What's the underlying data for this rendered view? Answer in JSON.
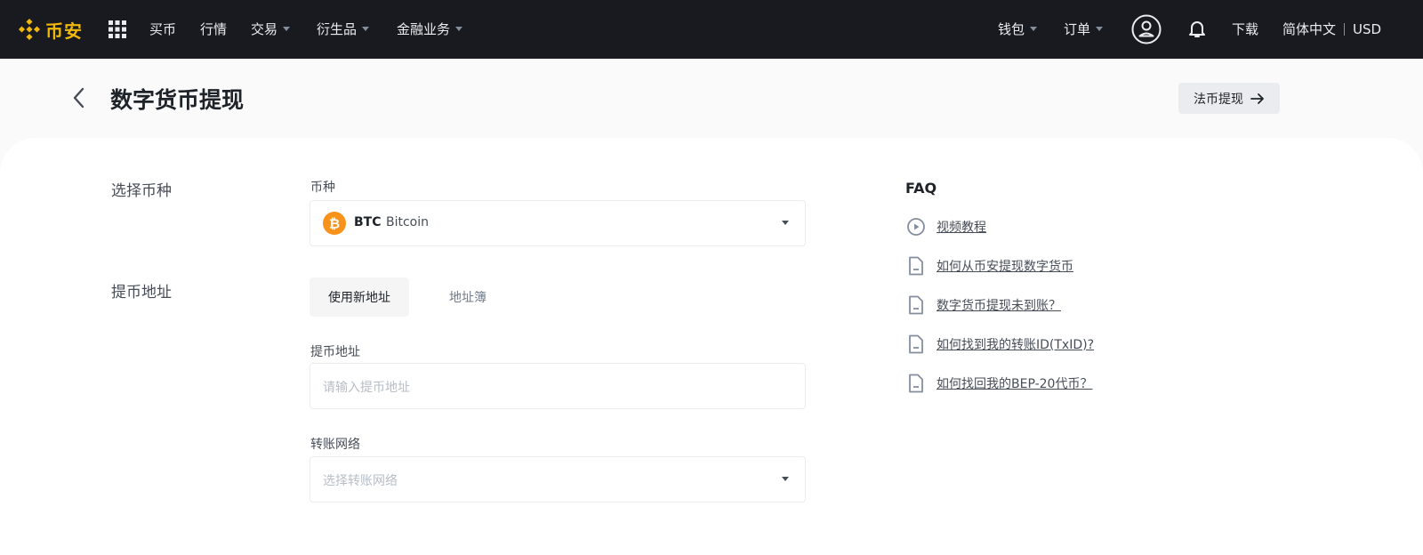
{
  "brand": {
    "name": "币安",
    "color": "#f0b90b",
    "icon": "binance-logo-icon"
  },
  "nav": {
    "items": [
      {
        "label": "买币",
        "dropdown": false
      },
      {
        "label": "行情",
        "dropdown": false
      },
      {
        "label": "交易",
        "dropdown": true
      },
      {
        "label": "衍生品",
        "dropdown": true
      },
      {
        "label": "金融业务",
        "dropdown": true
      }
    ],
    "right": {
      "wallet": "钱包",
      "orders": "订单",
      "download": "下载",
      "language": "简体中文",
      "currency": "USD"
    }
  },
  "header": {
    "title": "数字货币提现",
    "fiat_button": "法币提现"
  },
  "form": {
    "select_coin_section": "选择币种",
    "coin_label": "币种",
    "coin": {
      "symbol": "BTC",
      "name": "Bitcoin",
      "icon": "bitcoin-icon",
      "icon_color": "#f7931a"
    },
    "address_section": "提币地址",
    "tabs": [
      {
        "label": "使用新地址",
        "active": true
      },
      {
        "label": "地址簿",
        "active": false
      }
    ],
    "address_label": "提币地址",
    "address_placeholder": "请输入提币地址",
    "network_label": "转账网络",
    "network_placeholder": "选择转账网络"
  },
  "faq": {
    "title": "FAQ",
    "items": [
      {
        "icon": "play-icon",
        "text": "视频教程"
      },
      {
        "icon": "document-icon",
        "text": "如何从币安提现数字货币"
      },
      {
        "icon": "document-icon",
        "text": "数字货币提现未到账？"
      },
      {
        "icon": "document-icon",
        "text": "如何找到我的转账ID(TxID)?"
      },
      {
        "icon": "document-icon",
        "text": "如何找回我的BEP-20代币？"
      }
    ]
  }
}
